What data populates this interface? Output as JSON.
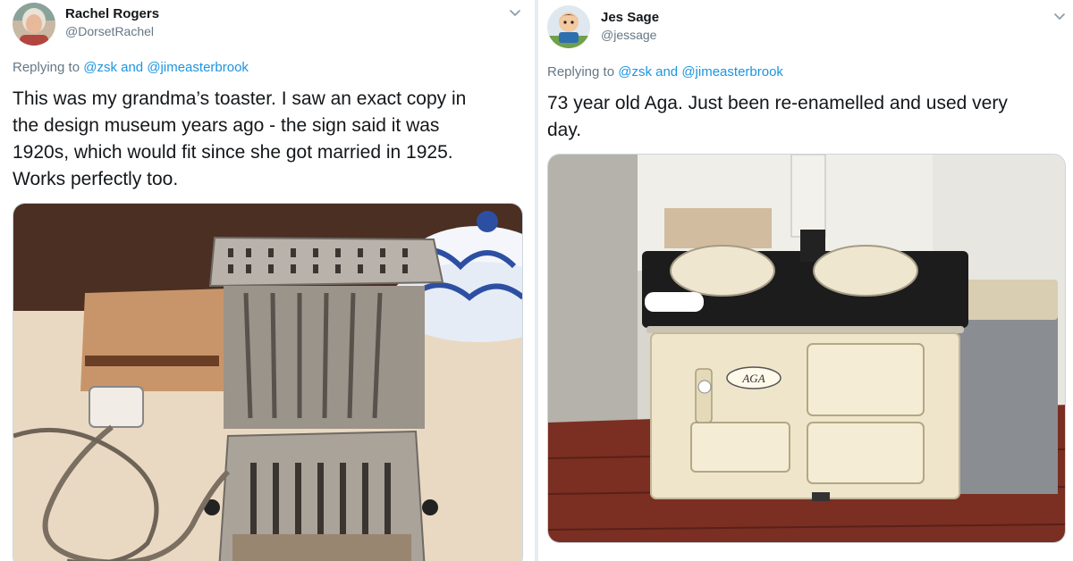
{
  "tweets": [
    {
      "name": "Rachel Rogers",
      "handle": "@DorsetRachel",
      "reply_prefix": "Replying to",
      "reply_user1": "@zsk",
      "reply_and": "and",
      "reply_user2": "@jimeasterbrook",
      "text_lines": [
        "This was my grandma’s toaster.  I saw an exact copy in",
        "the design museum years ago - the sign said it was",
        "1920s, which would fit since she got married in 1925.",
        "Works perfectly too."
      ],
      "media_icon": "toaster-photo"
    },
    {
      "name": "Jes Sage",
      "handle": "@jessage",
      "reply_prefix": "Replying to",
      "reply_user1": "@zsk",
      "reply_and": "and",
      "reply_user2": "@jimeasterbrook",
      "text_lines": [
        "73 year old Aga. Just been re-enamelled and used very",
        "day."
      ],
      "media_icon": "aga-stove-photo",
      "stove_badge": "AGA"
    }
  ],
  "colors": {
    "link": "#1b95e0",
    "secondary_text": "#657786",
    "primary_text": "#14171a",
    "border": "#ccd6dd"
  },
  "icons": [
    "avatar-rachel",
    "avatar-jes",
    "chevron-down-icon"
  ]
}
